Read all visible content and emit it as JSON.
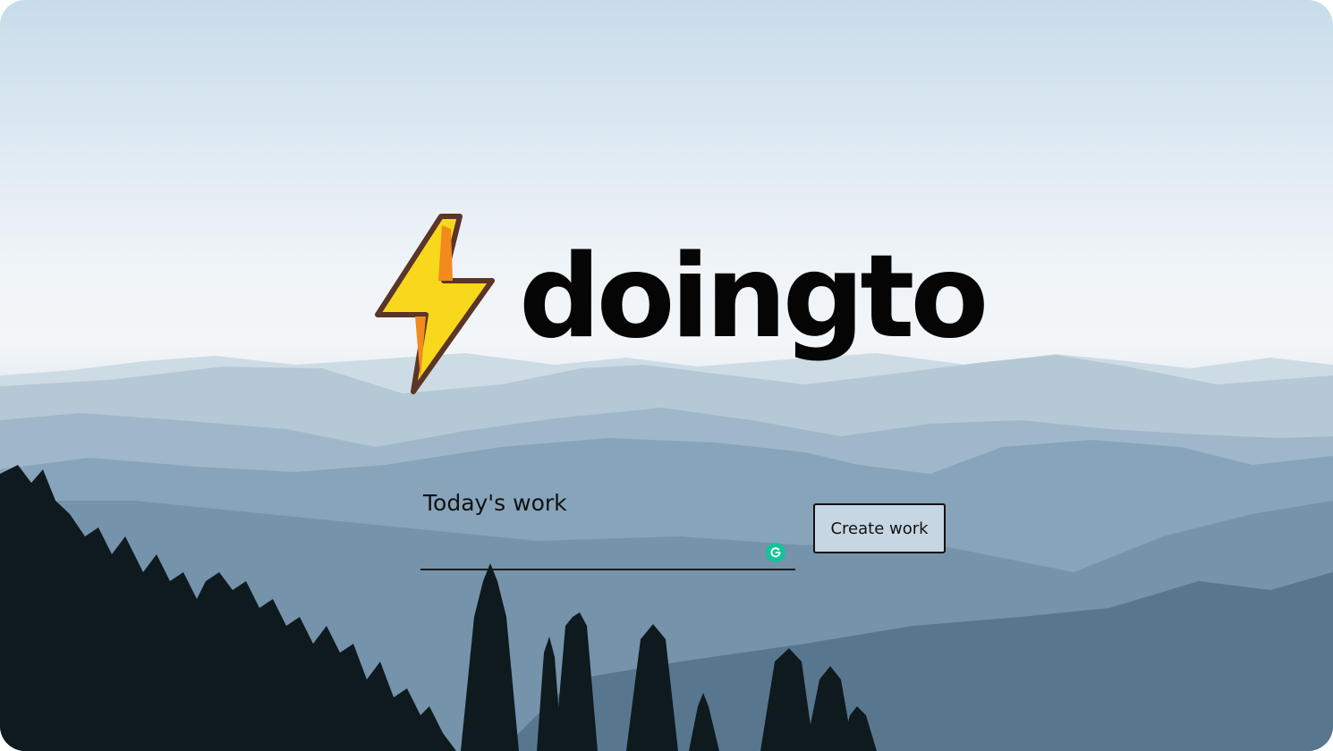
{
  "app": {
    "name": "doingto"
  },
  "form": {
    "label": "Today's work",
    "input_value": "",
    "input_placeholder": "",
    "create_label": "Create work"
  },
  "icons": {
    "logo": "lightning-bolt-icon",
    "grammar": "grammarly-g-icon"
  },
  "colors": {
    "bolt_fill": "#f7d81c",
    "bolt_shade": "#f28a1e",
    "bolt_outline": "#5a3528",
    "button_bg": "#c6d6e2",
    "grammar_badge": "#15c39a"
  }
}
